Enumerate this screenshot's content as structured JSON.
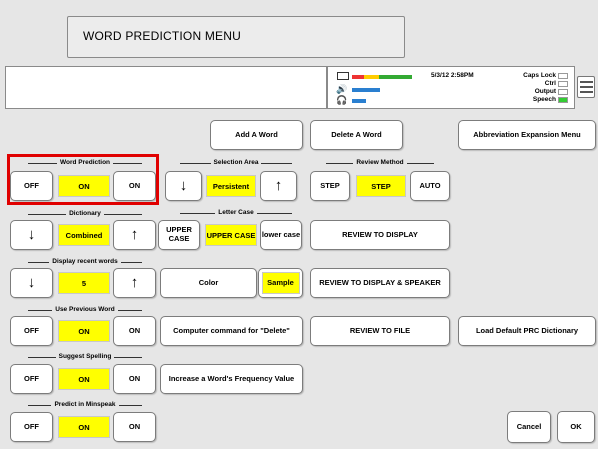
{
  "title": "WORD PREDICTION MENU",
  "status": {
    "datetime": "5/3/12 2:58PM",
    "caps_lock": "Caps Lock",
    "ctrl": "Ctrl",
    "output": "Output",
    "speech": "Speech"
  },
  "top_buttons": {
    "add_word": "Add A Word",
    "delete_word": "Delete A Word",
    "abbreviation": "Abbreviation Expansion Menu"
  },
  "word_prediction": {
    "label": "Word Prediction",
    "off": "OFF",
    "value": "ON",
    "on": "ON"
  },
  "selection_area": {
    "label": "Selection Area",
    "value": "Persistent",
    "down": "↓",
    "up": "↑"
  },
  "review_method": {
    "label": "Review Method",
    "step": "STEP",
    "value": "STEP",
    "auto": "AUTO"
  },
  "dictionary": {
    "label": "Dictionary",
    "value": "Combined",
    "down": "↓",
    "up": "↑"
  },
  "letter_case": {
    "label": "Letter Case",
    "upper": "UPPER CASE",
    "value": "UPPER CASE",
    "lower": "lower case"
  },
  "review_display": "REVIEW TO DISPLAY",
  "display_recent": {
    "label": "Display recent words",
    "value": "5",
    "down": "↓",
    "up": "↑"
  },
  "color": {
    "label": "Color",
    "value": "Sample"
  },
  "review_display_speaker": "REVIEW TO DISPLAY & SPEAKER",
  "use_previous": {
    "label": "Use Previous Word",
    "off": "OFF",
    "value": "ON",
    "on": "ON"
  },
  "computer_command": "Computer command for \"Delete\"",
  "review_file": "REVIEW TO FILE",
  "load_default": "Load Default PRC Dictionary",
  "suggest_spelling": {
    "label": "Suggest Spelling",
    "off": "OFF",
    "value": "ON",
    "on": "ON"
  },
  "increase_frequency": "Increase a Word's Frequency Value",
  "predict_minspeak": {
    "label": "Predict in Minspeak",
    "off": "OFF",
    "value": "ON",
    "on": "ON"
  },
  "cancel": "Cancel",
  "ok": "OK",
  "colors": {
    "highlight": "#ffff00",
    "selection_frame": "#e00000",
    "speech_indicator": "#33cc33"
  }
}
